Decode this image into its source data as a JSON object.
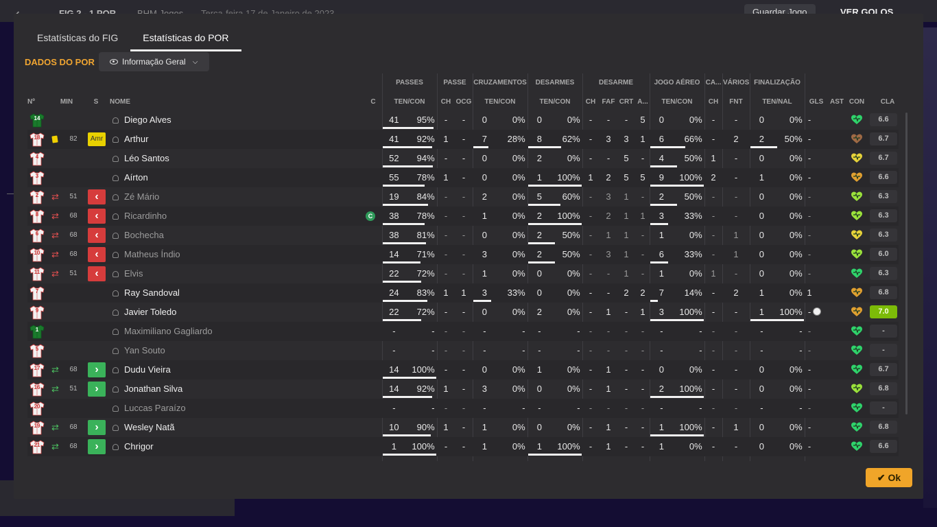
{
  "background": {
    "back_icon": "arrow-left-icon",
    "teams": "FIG  2 - 1  POR",
    "club": "BHM Jogos",
    "date": "Terça-feira 17 de Janeiro de 2023",
    "save_label": "Guardar Jogo",
    "goals_label": "VER GOLOS"
  },
  "tabs": [
    {
      "label": "Estatísticas do FIG"
    },
    {
      "label": "Estatísticas do POR",
      "active": true
    }
  ],
  "section": {
    "title": "DADOS DO POR",
    "dropdown": "Informação Geral"
  },
  "groups": [
    "PASSES",
    "PASSE",
    "CRUZAMENTOS",
    "DESARMES",
    "DESARME",
    "JOGO AÉREO",
    "CA...",
    "VÁRIOS",
    "FINALIZAÇÃO"
  ],
  "columns": {
    "num": "Nº",
    "min": "MIN",
    "s": "S",
    "name": "NOME",
    "c": "C",
    "passes": "TEN/CON",
    "ch1": "CH",
    "ocg": "OCG",
    "cross": "TEN/CON",
    "tack": "TEN/CON",
    "ch2": "CH",
    "faf": "FAF",
    "crt": "CRT",
    "a": "A...",
    "aerial": "TEN/CON",
    "ch3": "CH",
    "fnt": "FNT",
    "shots": "TEN/NAL",
    "gls": "GLS",
    "ast": "AST",
    "con": "CON",
    "cla": "CLA"
  },
  "colors": {
    "accent": "#f0a531",
    "sub_out": "#d63c3c",
    "sub_in": "#3ab25a",
    "best_rating": "#7cbb08",
    "yellow_card": "#e8d100"
  },
  "rows": [
    {
      "num": "14",
      "gk": true,
      "name": "Diego Alves",
      "p": [
        "41",
        "95%"
      ],
      "pf": 0.95,
      "ch1": "-",
      "ocg": "-",
      "cr": [
        "0",
        "0%"
      ],
      "crf": 0,
      "tk": [
        "0",
        "0%"
      ],
      "tkf": 0,
      "ch2": "-",
      "faf": "-",
      "crt": "-",
      "a": "5",
      "ae": [
        "0",
        "0%"
      ],
      "aef": 0,
      "ch3": "-",
      "fnt": "-",
      "sh": [
        "0",
        "0%"
      ],
      "shf": 0,
      "gls": "",
      "ast": "-",
      "con": "green",
      "cla": "6.6"
    },
    {
      "num": "18",
      "name": "Arthur",
      "card": "yellow",
      "min": "82",
      "badge": "Amr",
      "p": [
        "41",
        "92%"
      ],
      "pf": 0.92,
      "ch1": "1",
      "ocg": "-",
      "cr": [
        "7",
        "28%"
      ],
      "crf": 0.28,
      "tk": [
        "8",
        "62%"
      ],
      "tkf": 0.62,
      "ch2": "-",
      "faf": "3",
      "crt": "3",
      "a": "1",
      "ae": [
        "6",
        "66%"
      ],
      "aef": 0.66,
      "ch3": "-",
      "fnt": "2",
      "sh": [
        "2",
        "50%"
      ],
      "shf": 0.5,
      "gls": "",
      "ast": "-",
      "con": "brown",
      "cla": "6.7"
    },
    {
      "num": "4",
      "name": "Léo Santos",
      "p": [
        "52",
        "94%"
      ],
      "pf": 0.94,
      "ch1": "-",
      "ocg": "-",
      "cr": [
        "0",
        "0%"
      ],
      "crf": 0,
      "tk": [
        "2",
        "0%"
      ],
      "tkf": 0,
      "ch2": "-",
      "faf": "-",
      "crt": "5",
      "a": "-",
      "ae": [
        "4",
        "50%"
      ],
      "aef": 0.5,
      "ch3": "1",
      "fnt": "-",
      "sh": [
        "0",
        "0%"
      ],
      "shf": 0,
      "gls": "",
      "ast": "-",
      "con": "yellow",
      "cla": "6.7"
    },
    {
      "num": "3",
      "name": "Aírton",
      "p": [
        "55",
        "78%"
      ],
      "pf": 0.78,
      "ch1": "1",
      "ocg": "-",
      "cr": [
        "0",
        "0%"
      ],
      "crf": 0,
      "tk": [
        "1",
        "100%"
      ],
      "tkf": 1,
      "ch2": "1",
      "faf": "2",
      "crt": "5",
      "a": "5",
      "ae": [
        "9",
        "100%"
      ],
      "aef": 1,
      "ch3": "2",
      "fnt": "-",
      "sh": [
        "1",
        "0%"
      ],
      "shf": 0,
      "gls": "",
      "ast": "-",
      "con": "orange",
      "cla": "6.6"
    },
    {
      "num": "2",
      "name": "Zé Mário",
      "dim": true,
      "swap": "out",
      "min": "51",
      "p": [
        "19",
        "84%"
      ],
      "pf": 0.84,
      "ch1": "-",
      "ocg": "-",
      "cr": [
        "2",
        "0%"
      ],
      "crf": 0,
      "tk": [
        "5",
        "60%"
      ],
      "tkf": 0.6,
      "ch2": "-",
      "faf": "3",
      "crt": "1",
      "a": "-",
      "ae": [
        "2",
        "50%"
      ],
      "aef": 0.5,
      "ch3": "-",
      "fnt": "-",
      "sh": [
        "0",
        "0%"
      ],
      "shf": 0,
      "gls": "",
      "ast": "-",
      "con": "lime",
      "cla": "6.3"
    },
    {
      "num": "8",
      "name": "Ricardinho",
      "dim": true,
      "swap": "out",
      "min": "68",
      "captain": "C",
      "p": [
        "38",
        "78%"
      ],
      "pf": 0.78,
      "ch1": "-",
      "ocg": "-",
      "cr": [
        "1",
        "0%"
      ],
      "crf": 0,
      "tk": [
        "2",
        "100%"
      ],
      "tkf": 1,
      "ch2": "-",
      "faf": "2",
      "crt": "1",
      "a": "1",
      "ae": [
        "3",
        "33%"
      ],
      "aef": 0.33,
      "ch3": "-",
      "fnt": "-",
      "sh": [
        "0",
        "0%"
      ],
      "shf": 0,
      "gls": "",
      "ast": "-",
      "con": "lime",
      "cla": "6.3"
    },
    {
      "num": "6",
      "name": "Bochecha",
      "dim": true,
      "swap": "out",
      "min": "68",
      "p": [
        "38",
        "81%"
      ],
      "pf": 0.81,
      "ch1": "-",
      "ocg": "-",
      "cr": [
        "0",
        "0%"
      ],
      "crf": 0,
      "tk": [
        "2",
        "50%"
      ],
      "tkf": 0.5,
      "ch2": "-",
      "faf": "1",
      "crt": "1",
      "a": "-",
      "ae": [
        "1",
        "0%"
      ],
      "aef": 0,
      "ch3": "-",
      "fnt": "1",
      "sh": [
        "0",
        "0%"
      ],
      "shf": 0,
      "gls": "",
      "ast": "-",
      "con": "yellow",
      "cla": "6.3"
    },
    {
      "num": "10",
      "name": "Matheus Índio",
      "dim": true,
      "swap": "out",
      "min": "68",
      "p": [
        "14",
        "71%"
      ],
      "pf": 0.71,
      "ch1": "-",
      "ocg": "-",
      "cr": [
        "3",
        "0%"
      ],
      "crf": 0,
      "tk": [
        "2",
        "50%"
      ],
      "tkf": 0.5,
      "ch2": "-",
      "faf": "3",
      "crt": "1",
      "a": "-",
      "ae": [
        "6",
        "33%"
      ],
      "aef": 0.33,
      "ch3": "-",
      "fnt": "1",
      "sh": [
        "0",
        "0%"
      ],
      "shf": 0,
      "gls": "",
      "ast": "-",
      "con": "lime",
      "cla": "6.0"
    },
    {
      "num": "11",
      "name": "Elvis",
      "dim": true,
      "swap": "out",
      "min": "51",
      "p": [
        "22",
        "72%"
      ],
      "pf": 0.72,
      "ch1": "-",
      "ocg": "-",
      "cr": [
        "1",
        "0%"
      ],
      "crf": 0,
      "tk": [
        "0",
        "0%"
      ],
      "tkf": 0,
      "ch2": "-",
      "faf": "-",
      "crt": "1",
      "a": "-",
      "ae": [
        "1",
        "0%"
      ],
      "aef": 0,
      "ch3": "1",
      "fnt": "-",
      "sh": [
        "0",
        "0%"
      ],
      "shf": 0,
      "gls": "",
      "ast": "-",
      "con": "green",
      "cla": "6.3"
    },
    {
      "num": "7",
      "name": "Ray Sandoval",
      "p": [
        "24",
        "83%"
      ],
      "pf": 0.83,
      "ch1": "1",
      "ocg": "1",
      "cr": [
        "3",
        "33%"
      ],
      "crf": 0.33,
      "tk": [
        "0",
        "0%"
      ],
      "tkf": 0,
      "ch2": "-",
      "faf": "-",
      "crt": "2",
      "a": "2",
      "ae": [
        "7",
        "14%"
      ],
      "aef": 0.14,
      "ch3": "-",
      "fnt": "2",
      "sh": [
        "1",
        "0%"
      ],
      "shf": 0,
      "gls": "",
      "ast": "1",
      "con": "orange",
      "cla": "6.8"
    },
    {
      "num": "9",
      "name": "Javier Toledo",
      "p": [
        "22",
        "72%"
      ],
      "pf": 0.72,
      "ch1": "-",
      "ocg": "-",
      "cr": [
        "0",
        "0%"
      ],
      "crf": 0,
      "tk": [
        "2",
        "0%"
      ],
      "tkf": 0,
      "ch2": "-",
      "faf": "1",
      "crt": "-",
      "a": "1",
      "ae": [
        "3",
        "100%"
      ],
      "aef": 1,
      "ch3": "-",
      "fnt": "-",
      "sh": [
        "1",
        "100%"
      ],
      "shf": 1,
      "gls": "ball",
      "ast": "-",
      "con": "orange",
      "cla": "7.0",
      "best": true
    },
    {
      "num": "1",
      "gk": true,
      "name": "Maximiliano Gagliardo",
      "dim": true,
      "p": [
        "-",
        "-"
      ],
      "pf": -1,
      "ch1": "-",
      "ocg": "-",
      "cr": [
        "-",
        "-"
      ],
      "crf": -1,
      "tk": [
        "-",
        "-"
      ],
      "tkf": -1,
      "ch2": "-",
      "faf": "-",
      "crt": "-",
      "a": "-",
      "ae": [
        "-",
        "-"
      ],
      "aef": -1,
      "ch3": "-",
      "fnt": "-",
      "sh": [
        "-",
        "-"
      ],
      "shf": -1,
      "gls": "",
      "ast": "-",
      "con": "green",
      "cla": "-"
    },
    {
      "num": "5",
      "name": "Yan Souto",
      "dim": true,
      "p": [
        "-",
        "-"
      ],
      "pf": -1,
      "ch1": "-",
      "ocg": "-",
      "cr": [
        "-",
        "-"
      ],
      "crf": -1,
      "tk": [
        "-",
        "-"
      ],
      "tkf": -1,
      "ch2": "-",
      "faf": "-",
      "crt": "-",
      "a": "-",
      "ae": [
        "-",
        "-"
      ],
      "aef": -1,
      "ch3": "-",
      "fnt": "-",
      "sh": [
        "-",
        "-"
      ],
      "shf": -1,
      "gls": "",
      "ast": "-",
      "con": "green",
      "cla": "-"
    },
    {
      "num": "17",
      "name": "Dudu Vieira",
      "swap": "in",
      "min": "68",
      "p": [
        "14",
        "100%"
      ],
      "pf": 1,
      "ch1": "-",
      "ocg": "-",
      "cr": [
        "0",
        "0%"
      ],
      "crf": 0,
      "tk": [
        "1",
        "0%"
      ],
      "tkf": 0,
      "ch2": "-",
      "faf": "1",
      "crt": "-",
      "a": "-",
      "ae": [
        "0",
        "0%"
      ],
      "aef": 0,
      "ch3": "-",
      "fnt": "-",
      "sh": [
        "0",
        "0%"
      ],
      "shf": 0,
      "gls": "",
      "ast": "-",
      "con": "green",
      "cla": "6.7"
    },
    {
      "num": "16",
      "name": "Jonathan Silva",
      "swap": "in",
      "min": "51",
      "p": [
        "14",
        "92%"
      ],
      "pf": 0.92,
      "ch1": "1",
      "ocg": "-",
      "cr": [
        "3",
        "0%"
      ],
      "crf": 0,
      "tk": [
        "0",
        "0%"
      ],
      "tkf": 0,
      "ch2": "-",
      "faf": "1",
      "crt": "-",
      "a": "-",
      "ae": [
        "2",
        "100%"
      ],
      "aef": 1,
      "ch3": "-",
      "fnt": "-",
      "sh": [
        "0",
        "0%"
      ],
      "shf": 0,
      "gls": "",
      "ast": "-",
      "con": "lime",
      "cla": "6.8"
    },
    {
      "num": "20",
      "name": "Luccas Paraízo",
      "dim": true,
      "p": [
        "-",
        "-"
      ],
      "pf": -1,
      "ch1": "-",
      "ocg": "-",
      "cr": [
        "-",
        "-"
      ],
      "crf": -1,
      "tk": [
        "-",
        "-"
      ],
      "tkf": -1,
      "ch2": "-",
      "faf": "-",
      "crt": "-",
      "a": "-",
      "ae": [
        "-",
        "-"
      ],
      "aef": -1,
      "ch3": "-",
      "fnt": "-",
      "sh": [
        "-",
        "-"
      ],
      "shf": -1,
      "gls": "",
      "ast": "-",
      "con": "green",
      "cla": "-"
    },
    {
      "num": "19",
      "name": "Wesley Natã",
      "swap": "in",
      "min": "68",
      "p": [
        "10",
        "90%"
      ],
      "pf": 0.9,
      "ch1": "1",
      "ocg": "-",
      "cr": [
        "1",
        "0%"
      ],
      "crf": 0,
      "tk": [
        "0",
        "0%"
      ],
      "tkf": 0,
      "ch2": "-",
      "faf": "1",
      "crt": "-",
      "a": "-",
      "ae": [
        "1",
        "100%"
      ],
      "aef": 1,
      "ch3": "-",
      "fnt": "1",
      "sh": [
        "0",
        "0%"
      ],
      "shf": 0,
      "gls": "",
      "ast": "-",
      "con": "green",
      "cla": "6.8"
    },
    {
      "num": "21",
      "name": "Chrigor",
      "swap": "in",
      "min": "68",
      "p": [
        "1",
        "100%"
      ],
      "pf": 1,
      "ch1": "-",
      "ocg": "-",
      "cr": [
        "1",
        "0%"
      ],
      "crf": 0,
      "tk": [
        "1",
        "100%"
      ],
      "tkf": 1,
      "ch2": "-",
      "faf": "1",
      "crt": "-",
      "a": "-",
      "ae": [
        "1",
        "0%"
      ],
      "aef": 0,
      "ch3": "-",
      "fnt": "-",
      "sh": [
        "0",
        "0%"
      ],
      "shf": 0,
      "gls": "",
      "ast": "-",
      "con": "green",
      "cla": "6.6"
    }
  ],
  "ok_label": "Ok"
}
